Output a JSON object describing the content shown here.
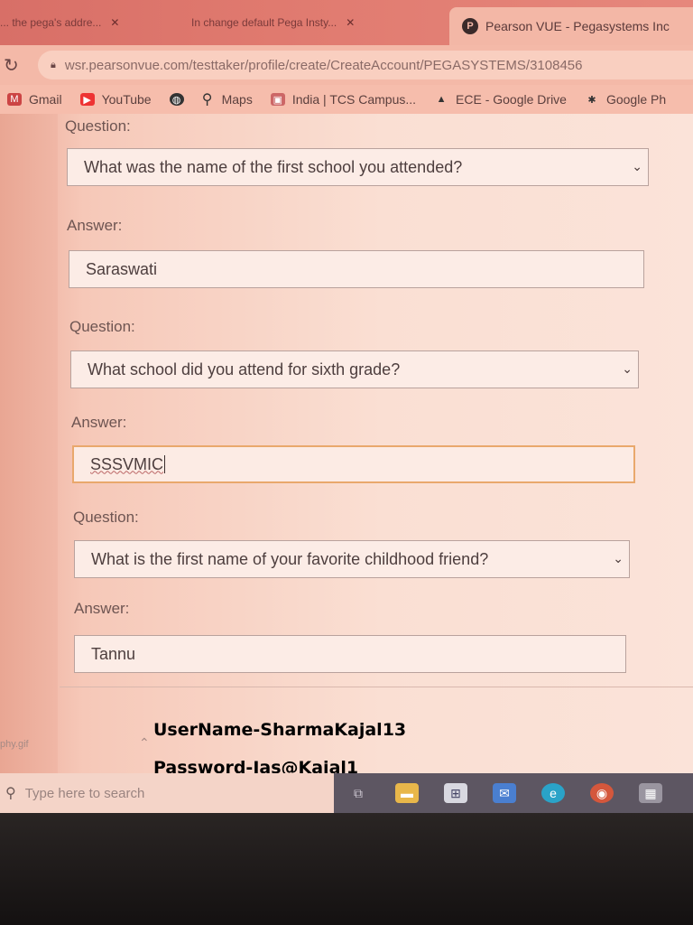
{
  "browser": {
    "tabs": [
      {
        "label": "... the pega's addre..."
      },
      {
        "label": "In change default Pega Insty..."
      }
    ],
    "active_tab": {
      "label": "Pearson VUE - Pegasystems Inc"
    },
    "url": "wsr.pearsonvue.com/testtaker/profile/create/CreateAccount/PEGASYSTEMS/3108456",
    "bookmarks": [
      {
        "label": "Gmail",
        "icon": "gmail-icon",
        "color": "#c44"
      },
      {
        "label": "YouTube",
        "icon": "youtube-icon",
        "color": "#e33"
      },
      {
        "label": "",
        "icon": "globe-icon",
        "color": "#333"
      },
      {
        "label": "Maps",
        "icon": "maps-pin-icon",
        "color": "#333"
      },
      {
        "label": "India | TCS Campus...",
        "icon": "tcs-icon",
        "color": "#c66"
      },
      {
        "label": "ECE - Google Drive",
        "icon": "drive-icon",
        "color": "#333"
      },
      {
        "label": "Google Ph",
        "icon": "photos-icon",
        "color": "#333"
      }
    ]
  },
  "form": {
    "items": [
      {
        "question_label": "Question:",
        "question": "What was the name of the first school you attended?",
        "answer_label": "Answer:",
        "answer": "Saraswati"
      },
      {
        "question_label": "Question:",
        "question": "What school did you attend for sixth grade?",
        "answer_label": "Answer:",
        "answer": "SSSVMIC"
      },
      {
        "question_label": "Question:",
        "question": "What is the first name of your favorite childhood friend?",
        "answer_label": "Answer:",
        "answer": "Tannu"
      }
    ]
  },
  "download_bar": {
    "filename": "phy.gif"
  },
  "overlay": {
    "username": "UserName-SharmaKajal13",
    "password": "Password-Ias@Kajal1"
  },
  "taskbar": {
    "search_placeholder": "Type here to search",
    "icons": [
      "task-view-icon",
      "file-explorer-icon",
      "store-icon",
      "mail-icon",
      "edge-icon",
      "chrome-icon",
      "app-icon"
    ]
  }
}
